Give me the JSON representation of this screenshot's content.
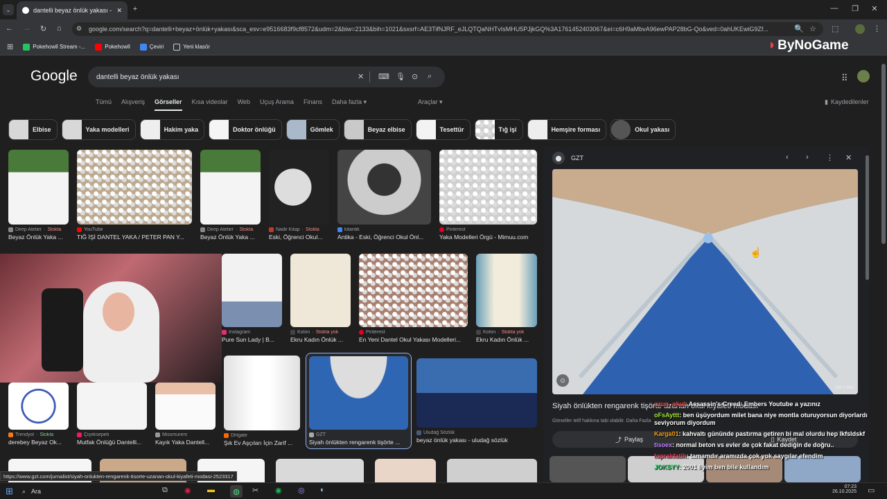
{
  "browser": {
    "tab_title": "dantelli beyaz önlük yakası - Go",
    "new_tab": "+",
    "url": "google.com/search?q=dantelli+beyaz+önlük+yakası&sca_esv=e9516683f9cf8572&udm=2&biw=2133&bih=1021&sxsrf=AE3TifNJRF_eJLQTQaNHTvIsMHU5PJjkGQ%3A1761452403067&ei=c6H9aMbvA96ewPAP28bG-Qo&ved=0ahUKEwiG9Zf...",
    "bookmarks": [
      {
        "label": "Pokehowll Stream -..."
      },
      {
        "label": "Pokehowll"
      },
      {
        "label": "Çeviri"
      },
      {
        "label": "Yeni klasör"
      }
    ],
    "status_url": "https://www.gzt.com/jurnalist/siyah-onlukten-rengarenk-tisorte-uzanan-okul-kiyafeti-modasi-2523317"
  },
  "overlay": {
    "brand": "ByNoGame"
  },
  "google": {
    "logo": "Google",
    "query": "dantelli beyaz önlük yakası",
    "tabs": [
      "Tümü",
      "Alışveriş",
      "Görseller",
      "Kısa videolar",
      "Web",
      "Uçuş Arama",
      "Finans",
      "Daha fazla ▾"
    ],
    "tools": "Araçlar ▾",
    "saved": "Kaydedilenler",
    "chips": [
      "Elbise",
      "Yaka modelleri",
      "Hakim yaka",
      "Doktor önlüğü",
      "Gömlek",
      "Beyaz elbise",
      "Tesettür",
      "Tığ işi",
      "Hemşire forması",
      "Okul yakası"
    ]
  },
  "results": [
    {
      "source": "Deep Atelier",
      "stock": "Stokta",
      "title": "Beyaz Önlük Yaka ..."
    },
    {
      "source": "YouTube",
      "stock": "",
      "title": "TIĞ İŞİ DANTEL YAKA / PETER PAN Y..."
    },
    {
      "source": "Deep Atelier",
      "stock": "Stokta",
      "title": "Beyaz Önlük Yaka ..."
    },
    {
      "source": "Nadir Kitap",
      "stock": "Stokta",
      "title": "Eski, Öğrenci Okul..."
    },
    {
      "source": "kitantik",
      "stock": "",
      "title": "Antika - Eski, Öğrenci Okul Önl..."
    },
    {
      "source": "Pinterest",
      "stock": "",
      "title": "Yaka Modelleri Örgü - Mimuu.com"
    },
    {
      "source": "Instagram",
      "stock": "",
      "title": "Pure Sun Lady | B..."
    },
    {
      "source": "Koton",
      "stock": "Stokta yok",
      "title": "Ekru Kadın Önlük ..."
    },
    {
      "source": "Pinterest",
      "stock": "",
      "title": "En Yeni Dantel Okul Yakası Modelleri..."
    },
    {
      "source": "Koton",
      "stock": "Stokta yok",
      "title": "Ekru Kadın Önlük ..."
    },
    {
      "source": "Trendyol",
      "stock": "Stokta",
      "title": "derebey Beyaz Ok..."
    },
    {
      "source": "Çiçeksepeti",
      "stock": "",
      "title": "Mutfak Önlüğü Dantelli..."
    },
    {
      "source": "Missmurem",
      "stock": "",
      "title": "Kayık Yaka Dantell..."
    },
    {
      "source": "DHgate",
      "stock": "",
      "title": "Şık Ev Aşçıları İçin Zarif ..."
    },
    {
      "source": "GZT",
      "stock": "",
      "title": "Siyah önlükten rengarenk tişörte ..."
    },
    {
      "source": "Uludağ Sözlük",
      "stock": "",
      "title": "beyaz önlük yakası - uludağ sözlük"
    }
  ],
  "panel": {
    "source": "GZT",
    "dims": "900 × 663",
    "title": "Siyah önlükten rengarenk tişörte uzanan okul kıyafeti modası",
    "note": "Görseller telif hakkına tabi olabilir.",
    "more": "Daha Fazla",
    "share": "Paylaş",
    "save": "Kaydet"
  },
  "chat": [
    {
      "user": "uzun_okul",
      "msg": ": Assassin's Creed: Embers Youtube a yazınız",
      "color": "#ff4d4d"
    },
    {
      "user": "oFsAyttt",
      "msg": ": ben üşüyordum milet bana niye montla oturuyorsun diyorlardı seviyorum diyordum",
      "color": "#a3e635"
    },
    {
      "user": "Karga01",
      "msg": ": kahvaltı gününde pastırma getiren bi mal olurdu hep lkfsldskf",
      "color": "#f59e0b"
    },
    {
      "user": "tisoex",
      "msg": ": normal beton vs evler de çok fakat dediğin de doğru..",
      "color": "#c084fc"
    },
    {
      "user": "toprakfatih",
      "msg": ": tamamdır aramızda çok yok saygılar efendim",
      "color": "#f43f5e"
    },
    {
      "user": "JOKSYY",
      "msg": ": 2001 liyim ben bile kullandım",
      "color": "#22c55e"
    }
  ],
  "taskbar": {
    "search": "Ara",
    "time": "07:23",
    "date": "26.10.2025"
  }
}
